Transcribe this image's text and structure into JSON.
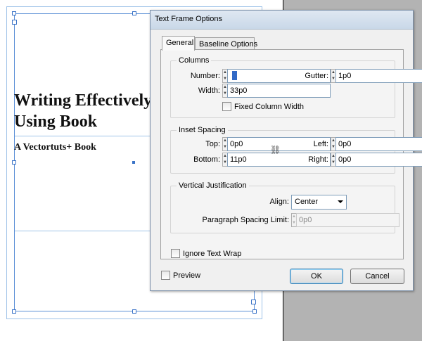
{
  "document": {
    "title_line1": "Writing Effectively",
    "title_line2": "Using Book",
    "subtitle": "A Vectortuts+ Book"
  },
  "dialog": {
    "title": "Text Frame Options",
    "tabs": [
      {
        "label": "General",
        "active": true
      },
      {
        "label": "Baseline Options",
        "active": false
      }
    ],
    "columns": {
      "legend": "Columns",
      "number_label": "Number:",
      "number_value": "1",
      "gutter_label": "Gutter:",
      "gutter_value": "1p0",
      "width_label": "Width:",
      "width_value": "33p0",
      "fixed_width_label": "Fixed Column Width"
    },
    "inset": {
      "legend": "Inset Spacing",
      "top_label": "Top:",
      "top_value": "0p0",
      "bottom_label": "Bottom:",
      "bottom_value": "11p0",
      "left_label": "Left:",
      "left_value": "0p0",
      "right_label": "Right:",
      "right_value": "0p0"
    },
    "vertical": {
      "legend": "Vertical Justification",
      "align_label": "Align:",
      "align_value": "Center",
      "para_spacing_label": "Paragraph Spacing Limit:",
      "para_spacing_value": "0p0"
    },
    "ignore_wrap_label": "Ignore Text Wrap",
    "preview_label": "Preview",
    "ok_label": "OK",
    "cancel_label": "Cancel"
  },
  "icons": {
    "chain": "chain-link-icon",
    "spin_up": "spin-up-arrow-icon",
    "spin_down": "spin-down-arrow-icon",
    "dropdown": "chevron-down-icon"
  },
  "colors": {
    "frame_selection": "#5b8fd6",
    "margin_guide": "#9fc3e8",
    "pasteboard": "#b3b3b3",
    "selection_highlight": "#3169c6",
    "ok_border": "#3c7fb1"
  }
}
